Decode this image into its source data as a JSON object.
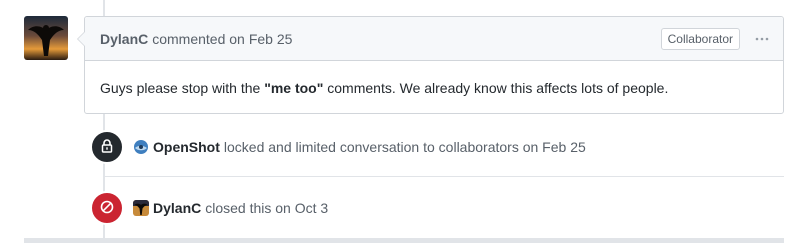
{
  "comment": {
    "author": "DylanC",
    "action": "commented on",
    "timestamp": "Feb 25",
    "role_badge": "Collaborator",
    "body_prefix": "Guys please stop with the ",
    "body_emphasis": "\"me too\"",
    "body_suffix": " comments. We already know this affects lots of people."
  },
  "events": {
    "lock": {
      "icon": "lock-icon",
      "actor": "OpenShot",
      "text": "locked and limited conversation to collaborators on Feb 25"
    },
    "close": {
      "icon": "circle-slash-icon",
      "actor": "DylanC",
      "text": "closed this on Oct 3"
    }
  },
  "colors": {
    "lock_badge": "#24292e",
    "closed_badge": "#cb2431"
  }
}
